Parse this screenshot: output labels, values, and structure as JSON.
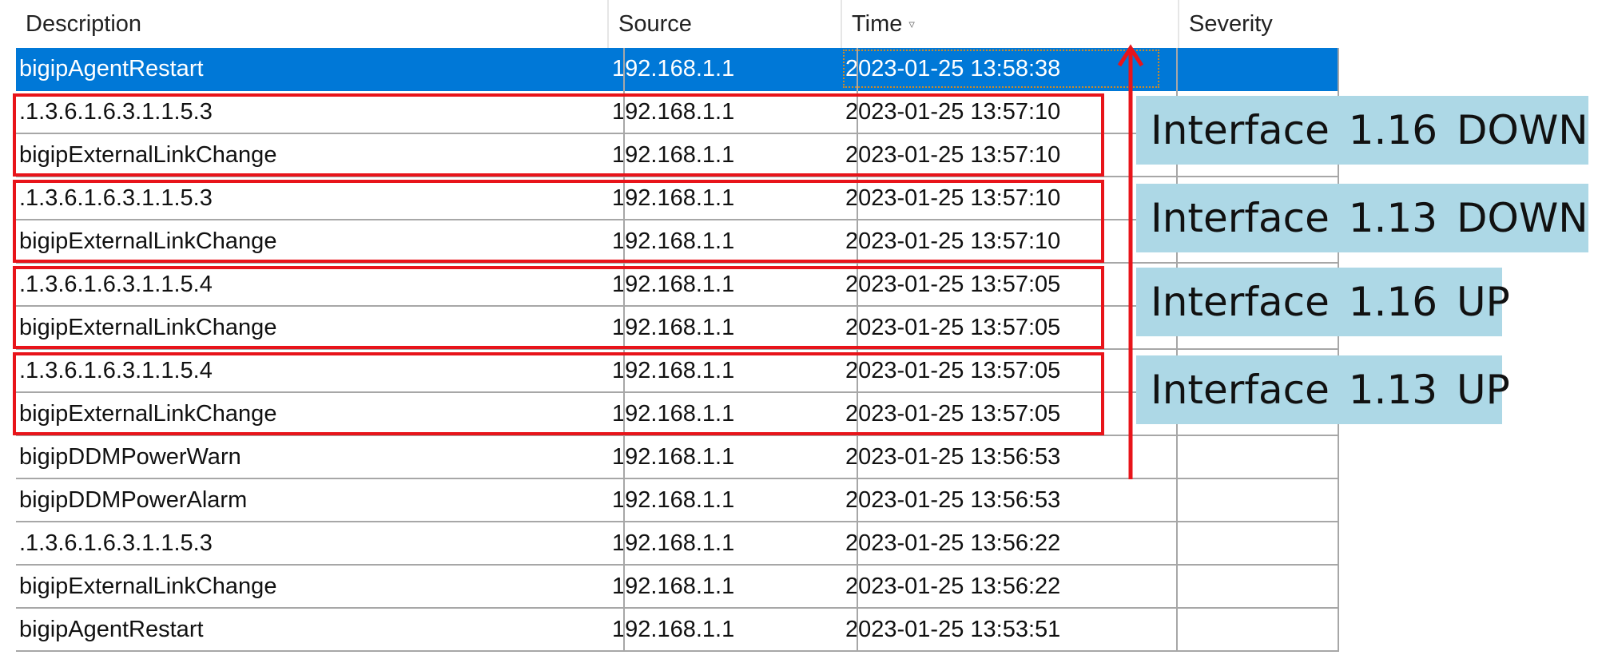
{
  "table": {
    "columns": [
      "Description",
      "Source",
      "Time",
      "Severity"
    ],
    "sort_indicator": "▿",
    "rows": [
      {
        "description": "bigipAgentRestart",
        "source": "192.168.1.1",
        "time": "2023-01-25 13:58:38",
        "severity": ""
      },
      {
        "description": ".1.3.6.1.6.3.1.1.5.3",
        "source": "192.168.1.1",
        "time": "2023-01-25 13:57:10",
        "severity": ""
      },
      {
        "description": "bigipExternalLinkChange",
        "source": "192.168.1.1",
        "time": "2023-01-25 13:57:10",
        "severity": ""
      },
      {
        "description": ".1.3.6.1.6.3.1.1.5.3",
        "source": "192.168.1.1",
        "time": "2023-01-25 13:57:10",
        "severity": ""
      },
      {
        "description": "bigipExternalLinkChange",
        "source": "192.168.1.1",
        "time": "2023-01-25 13:57:10",
        "severity": ""
      },
      {
        "description": ".1.3.6.1.6.3.1.1.5.4",
        "source": "192.168.1.1",
        "time": "2023-01-25 13:57:05",
        "severity": ""
      },
      {
        "description": "bigipExternalLinkChange",
        "source": "192.168.1.1",
        "time": "2023-01-25 13:57:05",
        "severity": ""
      },
      {
        "description": ".1.3.6.1.6.3.1.1.5.4",
        "source": "192.168.1.1",
        "time": "2023-01-25 13:57:05",
        "severity": ""
      },
      {
        "description": "bigipExternalLinkChange",
        "source": "192.168.1.1",
        "time": "2023-01-25 13:57:05",
        "severity": ""
      },
      {
        "description": "bigipDDMPowerWarn",
        "source": "192.168.1.1",
        "time": "2023-01-25 13:56:53",
        "severity": ""
      },
      {
        "description": "bigipDDMPowerAlarm",
        "source": "192.168.1.1",
        "time": "2023-01-25 13:56:53",
        "severity": ""
      },
      {
        "description": ".1.3.6.1.6.3.1.1.5.3",
        "source": "192.168.1.1",
        "time": "2023-01-25 13:56:22",
        "severity": ""
      },
      {
        "description": "bigipExternalLinkChange",
        "source": "192.168.1.1",
        "time": "2023-01-25 13:56:22",
        "severity": ""
      },
      {
        "description": "bigipAgentRestart",
        "source": "192.168.1.1",
        "time": "2023-01-25 13:53:51",
        "severity": ""
      }
    ],
    "selected_row": 0
  },
  "annotations": [
    "Interface 1.16 DOWN",
    "Interface 1.13 DOWN",
    "Interface 1.16 UP",
    "Interface 1.13 UP"
  ],
  "colors": {
    "selection": "#0078d7",
    "highlight_box": "#e8141a",
    "annotation_bg": "#add8e6",
    "arrow": "#e8141a"
  }
}
